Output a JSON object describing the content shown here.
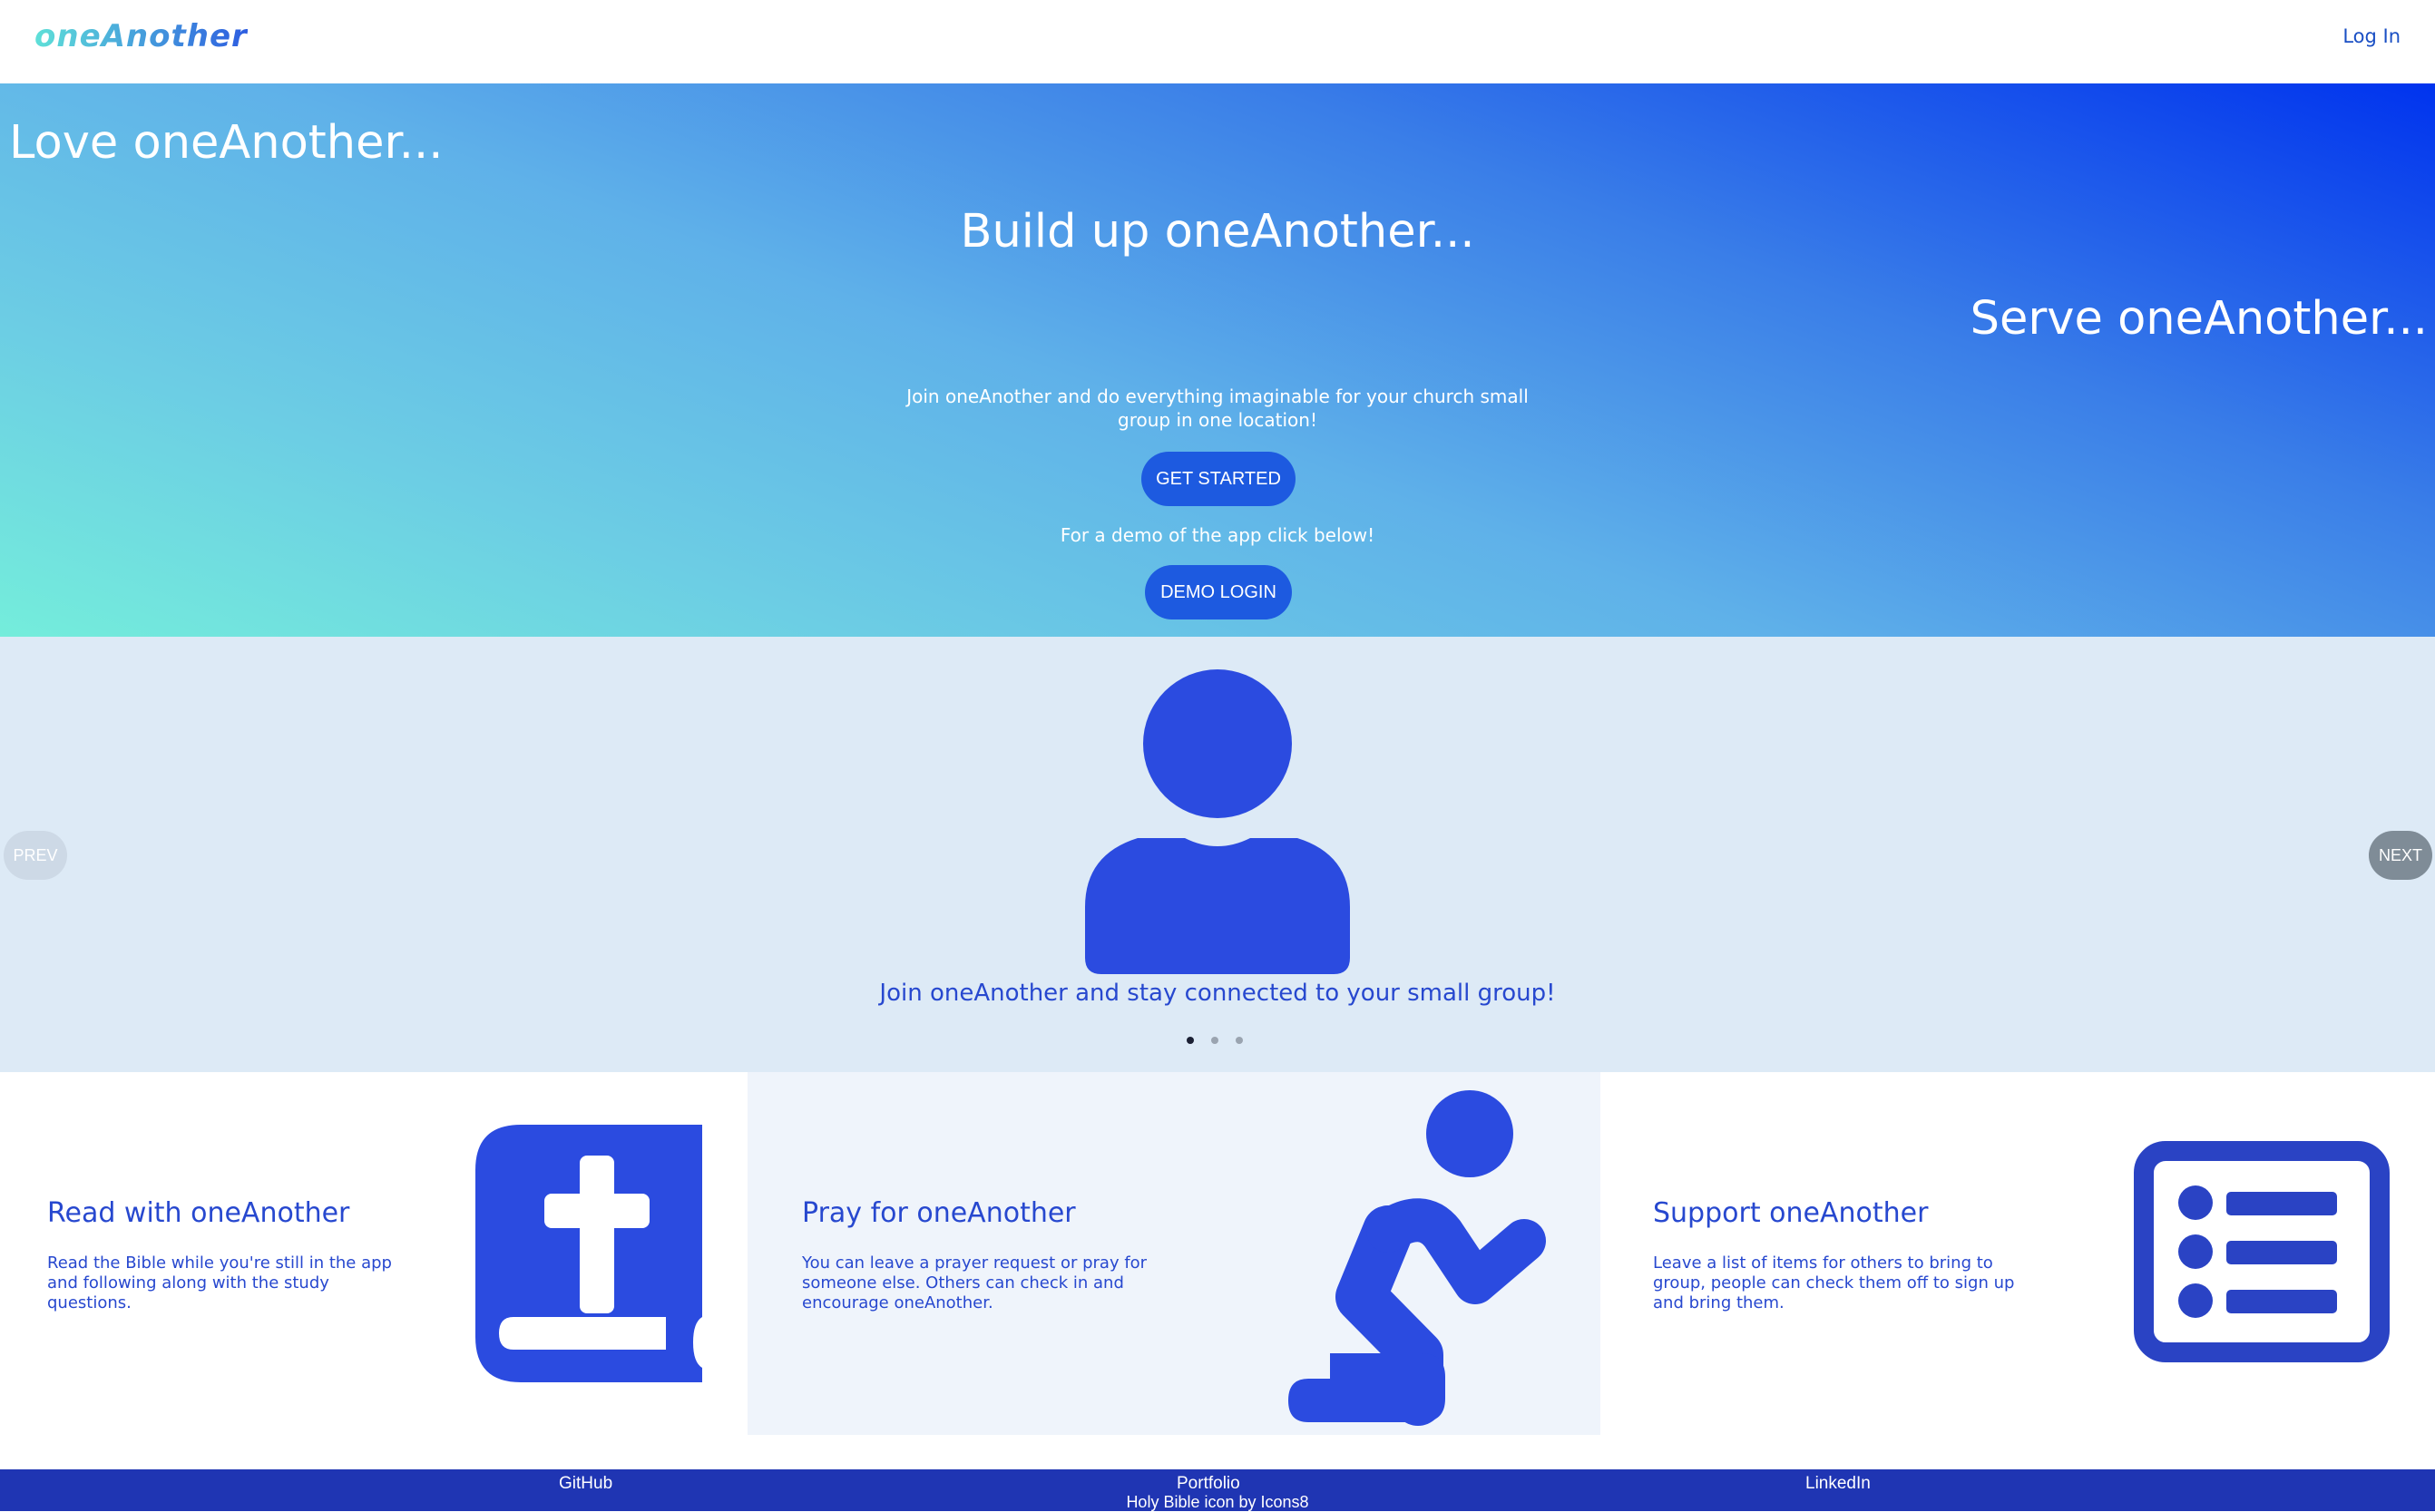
{
  "nav": {
    "logo": "oneAnother",
    "login_label": "Log In"
  },
  "hero": {
    "lines": [
      "Love oneAnother...",
      "Build up oneAnother...",
      "Serve oneAnother..."
    ],
    "intro": "Join oneAnother and do everything imaginable for your church small group in one location!",
    "start_label": "GET STARTED",
    "demo_note": "For a demo of the app click below!",
    "demo_label": "DEMO LOGIN"
  },
  "carousel": {
    "icon": "person-icon",
    "caption": "Join oneAnother and stay connected to your small group!",
    "prev_label": "PREV",
    "next_label": "NEXT",
    "slide_count": 3,
    "active_slide": 1
  },
  "features": [
    {
      "title": "Read with oneAnother",
      "desc": "Read the Bible while you're still in the app and following along with the study questions.",
      "icon": "bible-icon"
    },
    {
      "title": "Pray for oneAnother",
      "desc": "You can leave a prayer request or pray for someone else. Others can check in and encourage oneAnother.",
      "icon": "praying-person-icon"
    },
    {
      "title": "Support oneAnother",
      "desc": "Leave a list of items for others to bring to group, people can check them off to sign up and bring them.",
      "icon": "list-icon"
    }
  ],
  "footer": {
    "links": [
      "GitHub",
      "Portfolio",
      "LinkedIn"
    ],
    "credit": "Holy Bible icon by Icons8"
  },
  "colors": {
    "accent": "#2748cf",
    "button": "#1d5ae0",
    "footer": "#1f35b3",
    "carousel_bg": "#ddeaf6"
  }
}
